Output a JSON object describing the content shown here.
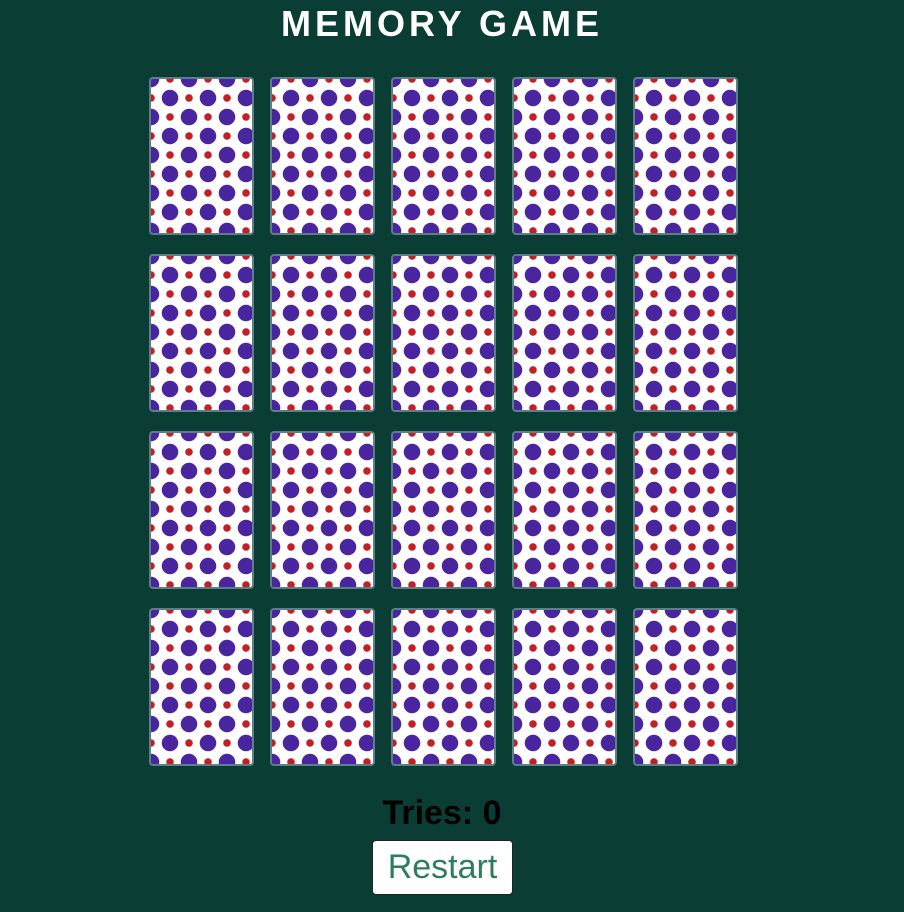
{
  "game": {
    "title": "MEMORY GAME",
    "card_back_colors": {
      "background": "#ffffff",
      "large_dot": "#4a25a0",
      "small_dot": "#c51f26",
      "border": "#5d7f88"
    },
    "rows": 4,
    "columns": 5,
    "cards": [
      {
        "state": "face-down"
      },
      {
        "state": "face-down"
      },
      {
        "state": "face-down"
      },
      {
        "state": "face-down"
      },
      {
        "state": "face-down"
      },
      {
        "state": "face-down"
      },
      {
        "state": "face-down"
      },
      {
        "state": "face-down"
      },
      {
        "state": "face-down"
      },
      {
        "state": "face-down"
      },
      {
        "state": "face-down"
      },
      {
        "state": "face-down"
      },
      {
        "state": "face-down"
      },
      {
        "state": "face-down"
      },
      {
        "state": "face-down"
      },
      {
        "state": "face-down"
      },
      {
        "state": "face-down"
      },
      {
        "state": "face-down"
      },
      {
        "state": "face-down"
      },
      {
        "state": "face-down"
      }
    ],
    "tries_label": "Tries:",
    "tries_value": "0",
    "tries_text": "Tries: 0",
    "restart_label": "Restart"
  },
  "colors": {
    "page_background": "#0a3d33",
    "title_color": "#ffffff",
    "restart_text": "#2e7d5e"
  }
}
